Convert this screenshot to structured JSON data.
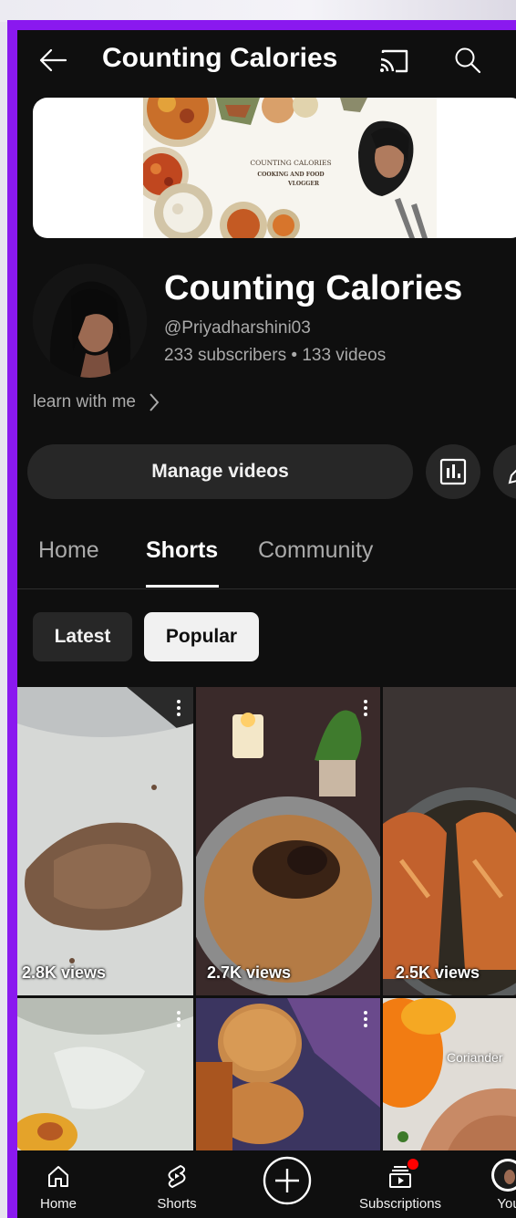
{
  "topbar": {
    "title": "Counting Calories",
    "back_icon": "arrow-left-icon",
    "cast_icon": "cast-icon",
    "search_icon": "search-icon"
  },
  "banner": {
    "line1": "COUNTING CALORIES",
    "line2": "COOKING AND FOOD",
    "line3": "VLOGGER"
  },
  "channel": {
    "name": "Counting Calories",
    "handle": "@Priyadharshini03",
    "stats": "233 subscribers • 133 videos",
    "description": "learn with me"
  },
  "actions": {
    "manage_label": "Manage videos",
    "analytics_icon": "analytics-icon",
    "edit_icon": "edit-icon"
  },
  "tabs": [
    {
      "label": "Home",
      "active": false
    },
    {
      "label": "Shorts",
      "active": true
    },
    {
      "label": "Community",
      "active": false
    }
  ],
  "chips": [
    {
      "label": "Latest",
      "selected": false
    },
    {
      "label": "Popular",
      "selected": true
    }
  ],
  "shorts": [
    {
      "views": "2.8K views",
      "tag": ""
    },
    {
      "views": "2.7K views",
      "tag": ""
    },
    {
      "views": "2.5K views",
      "tag": ""
    },
    {
      "views": "",
      "tag": ""
    },
    {
      "views": "",
      "tag": ""
    },
    {
      "views": "",
      "tag": "Coriander"
    }
  ],
  "nav": [
    {
      "label": "Home",
      "icon": "home-icon"
    },
    {
      "label": "Shorts",
      "icon": "shorts-icon"
    },
    {
      "label": "",
      "icon": "create-icon"
    },
    {
      "label": "Subscriptions",
      "icon": "subscriptions-icon",
      "badge": true
    },
    {
      "label": "You",
      "icon": "avatar"
    }
  ],
  "colors": {
    "background": "#0f0f0f",
    "frame": "#8a19ef",
    "chip_selected": "#f1f1f1",
    "notification": "#ff0000"
  }
}
